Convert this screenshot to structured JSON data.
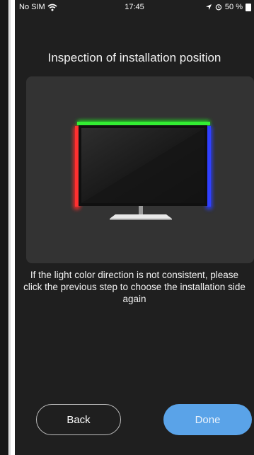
{
  "status_bar": {
    "carrier": "No SIM",
    "time": "17:45",
    "battery": "50 %",
    "icons": [
      "wifi-icon",
      "location-arrow-icon",
      "alarm-icon",
      "battery-icon"
    ]
  },
  "page": {
    "title": "Inspection of installation position",
    "hint": "If the light color direction is not consistent, please click the previous step to choose the installation side again"
  },
  "preview": {
    "colors": {
      "top": "#22dd22",
      "left": "#ff2a2a",
      "right": "#2a3cff",
      "panel": "#333333"
    }
  },
  "buttons": {
    "back_label": "Back",
    "done_label": "Done"
  },
  "colors": {
    "background": "#1f1f1f",
    "accent": "#5aa3e8"
  }
}
